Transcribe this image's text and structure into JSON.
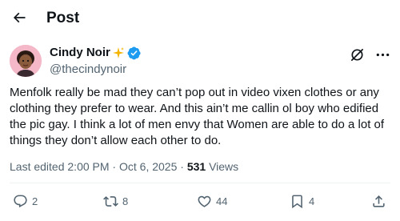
{
  "header": {
    "title": "Post",
    "back_icon": "arrow-left-icon"
  },
  "author": {
    "display_name": "Cindy Noir",
    "handle": "@thecindynoir",
    "badge_emoji": "sparkles",
    "verified_icon": "verified-badge-icon",
    "verified_color": "#1d9bf0"
  },
  "post": {
    "text": "Menfolk really be mad they can’t pop out in video vixen clothes or any clothing they prefer to wear. And this ain’t me callin ol boy who edified the pic gay. I think a lot of men envy that Women are able to do a lot of things they don’t allow each other to do."
  },
  "meta": {
    "last_edited_label": "Last edited",
    "time": "2:00 PM",
    "separator": "·",
    "date": "Oct 6, 2025",
    "views_count": "531",
    "views_label": "Views"
  },
  "actions": {
    "replies": "2",
    "reposts": "8",
    "likes": "44",
    "bookmarks": "4"
  },
  "colors": {
    "text": "#0f1419",
    "secondary": "#536471",
    "accent": "#1d9bf0",
    "divider": "#eff3f4"
  }
}
